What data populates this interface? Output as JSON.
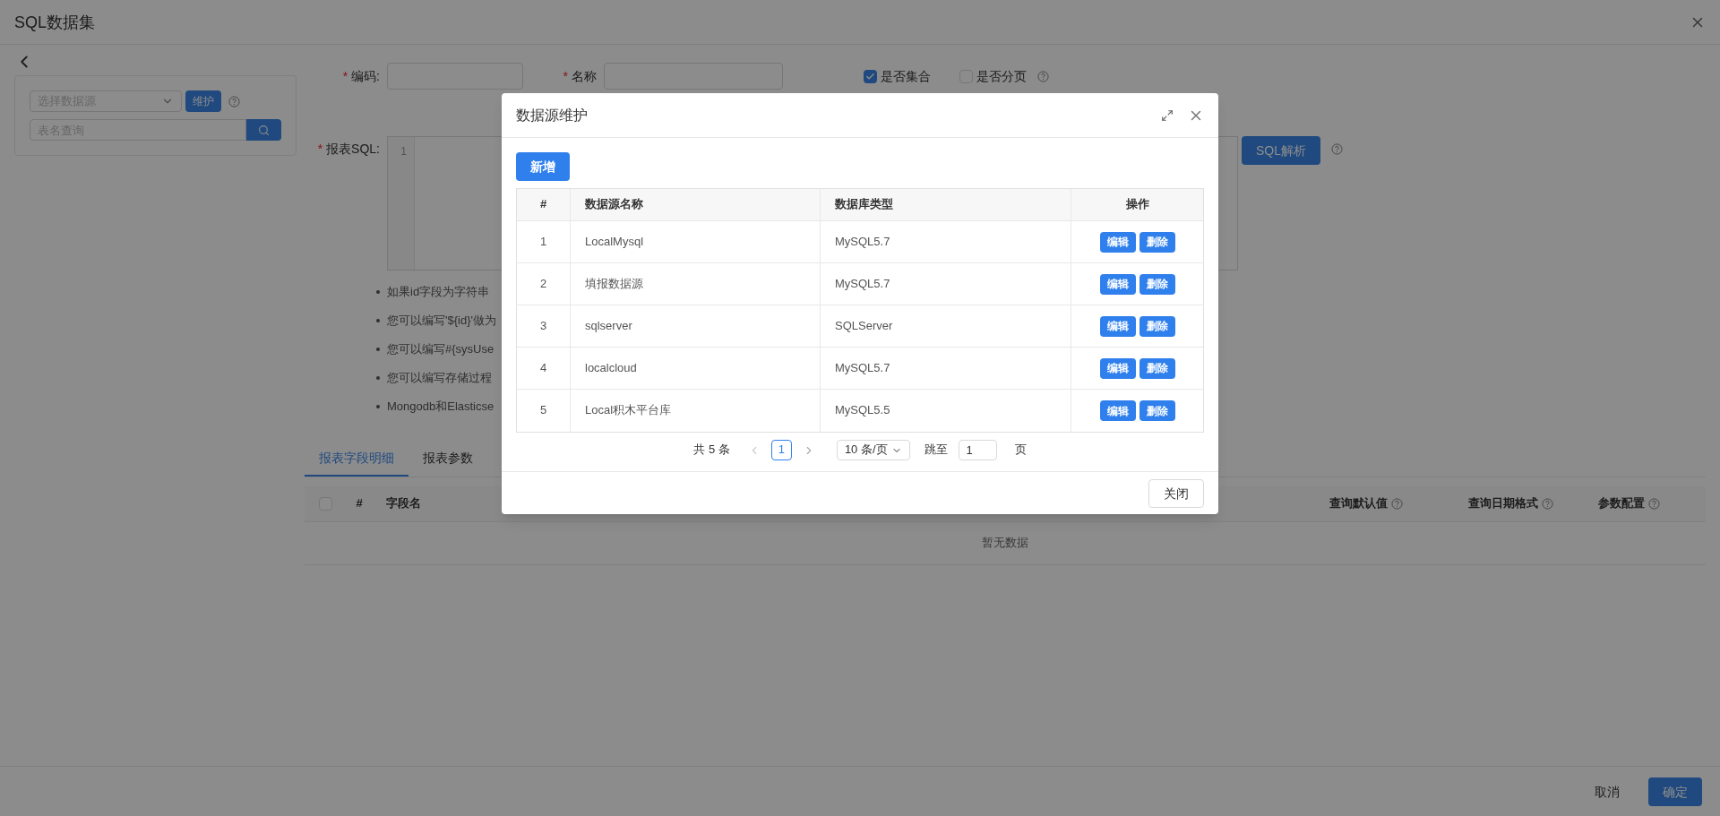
{
  "page": {
    "title": "SQL数据集"
  },
  "datasource_panel": {
    "select_placeholder": "选择数据源",
    "maintain_button": "维护",
    "search_placeholder": "表名查询"
  },
  "form": {
    "required_marks": [
      "*",
      "*",
      "*"
    ],
    "code_label": "编码:",
    "name_label": "名称",
    "sql_label": "报表SQL:",
    "line_numbers": [
      "1"
    ],
    "parse_button": "SQL解析",
    "checkboxes": [
      {
        "label": "是否集合",
        "checked": true,
        "help": false
      },
      {
        "label": "是否分页",
        "checked": false,
        "help": true
      }
    ]
  },
  "tips": [
    "如果id字段为字符串",
    "您可以编写'${id}'做为",
    "您可以编写#{sysUse",
    "您可以编写存储过程",
    "Mongodb和Elasticse"
  ],
  "tabs": [
    {
      "label": "报表字段明细",
      "selected": true
    },
    {
      "label": "报表参数",
      "selected": false
    }
  ],
  "fields_table": {
    "columns": [
      {
        "label": "#",
        "help": false
      },
      {
        "label": "字段名",
        "help": false
      },
      {
        "label": "查询默认值",
        "help": true
      },
      {
        "label": "查询日期格式",
        "help": true
      },
      {
        "label": "参数配置",
        "help": true
      }
    ],
    "select_all_checked": false,
    "empty_text": "暂无数据"
  },
  "footer": {
    "cancel": "取消",
    "confirm": "确定"
  },
  "modal": {
    "title": "数据源维护",
    "add_button": "新增",
    "columns": [
      "#",
      "数据源名称",
      "数据库类型",
      "操作"
    ],
    "rows": [
      {
        "index": "1",
        "name": "LocalMysql",
        "db_type": "MySQL5.7",
        "actions": [
          "编辑",
          "删除"
        ]
      },
      {
        "index": "2",
        "name": "填报数据源",
        "db_type": "MySQL5.7",
        "actions": [
          "编辑",
          "删除"
        ]
      },
      {
        "index": "3",
        "name": "sqlserver",
        "db_type": "SQLServer",
        "actions": [
          "编辑",
          "删除"
        ]
      },
      {
        "index": "4",
        "name": "localcloud",
        "db_type": "MySQL5.7",
        "actions": [
          "编辑",
          "删除"
        ]
      },
      {
        "index": "5",
        "name": "Local积木平台库",
        "db_type": "MySQL5.5",
        "actions": [
          "编辑",
          "删除"
        ]
      }
    ],
    "pagination": {
      "total": "共 5 条",
      "pages": [
        {
          "label": "1",
          "selected": true
        }
      ],
      "page_size": "10 条/页",
      "jump_label": "跳至",
      "jump_value": "1",
      "page_unit": "页"
    },
    "close_button": "关闭"
  }
}
